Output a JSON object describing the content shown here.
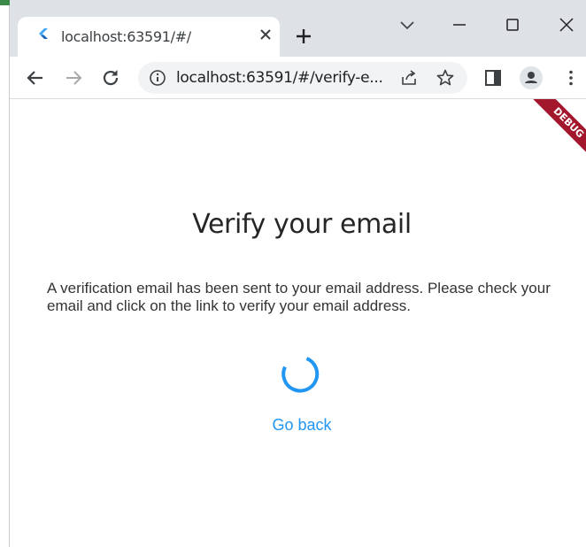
{
  "browser": {
    "tab": {
      "title": "localhost:63591/#/"
    },
    "omnibox": {
      "url": "localhost:63591/#/verify-e..."
    }
  },
  "app": {
    "debug_banner": "DEBUG",
    "title": "Verify your email",
    "message": "A verification email has been sent to your email address. Please check your email and click on the link to verify your email address.",
    "go_back_label": "Go back",
    "accent_color": "#2196f3",
    "debug_color": "#a3172d"
  },
  "icons": {
    "favicon": "flutter-icon",
    "tab_close": "close-icon",
    "new_tab": "plus-icon",
    "tab_search": "chevron-down-icon",
    "minimize": "minimize-icon",
    "maximize": "maximize-icon",
    "close_window": "close-icon",
    "back": "arrow-left-icon",
    "forward": "arrow-right-icon",
    "reload": "reload-icon",
    "site_info": "info-icon",
    "share": "share-icon",
    "bookmark": "star-icon",
    "side_panel": "side-panel-icon",
    "profile": "profile-icon",
    "menu": "kebab-menu-icon",
    "spinner": "loading-spinner"
  }
}
